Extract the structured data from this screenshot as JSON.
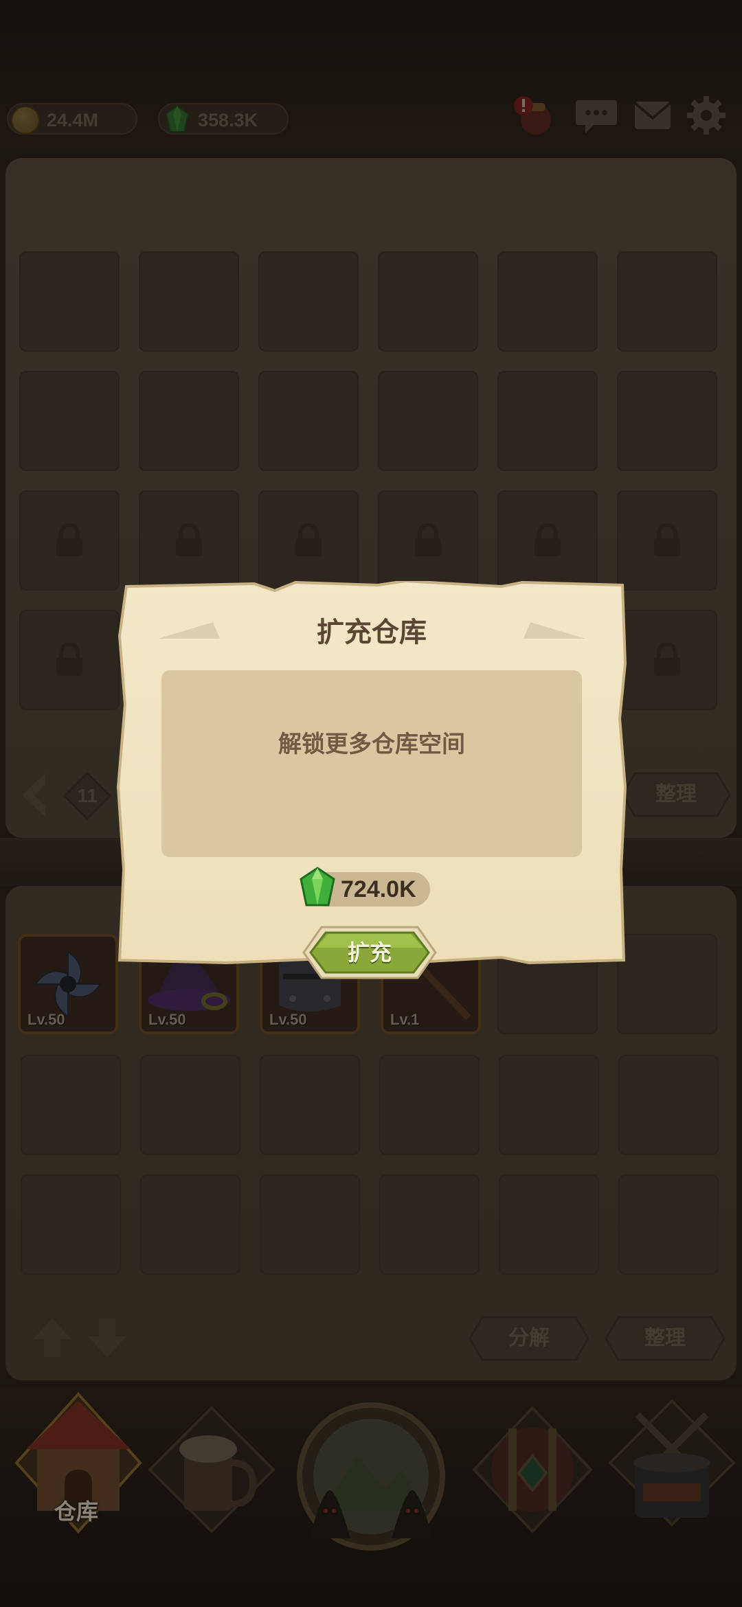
{
  "resources": {
    "gold": "24.4M",
    "gems": "358.3K"
  },
  "top_icons": [
    "alert-bag-icon",
    "chat-icon",
    "mail-icon",
    "gear-icon"
  ],
  "warehouse": {
    "page_number": "11",
    "sort_label_upper": "整理",
    "decompose_label": "分解",
    "sort_label_lower": "整理",
    "items": [
      {
        "level": "Lv.50",
        "icon": "shuriken-icon"
      },
      {
        "level": "Lv.50",
        "icon": "wizard-hat-icon"
      },
      {
        "level": "Lv.50",
        "icon": "helmet-icon"
      },
      {
        "level": "Lv.1",
        "icon": "axe-icon"
      }
    ]
  },
  "bottom_nav": {
    "warehouse_label": "仓库",
    "tabs": [
      "warehouse-icon",
      "tavern-icon",
      "adventure-portal-icon",
      "treasure-icon",
      "forge-icon"
    ]
  },
  "dialog": {
    "title": "扩充仓库",
    "description": "解锁更多仓库空间",
    "cost": "724.0K",
    "confirm_label": "扩充"
  },
  "colors": {
    "dialog_parchment": "#f0e3c2",
    "confirm_button": "#8aa83a",
    "gem_green": "#3fae3a"
  }
}
